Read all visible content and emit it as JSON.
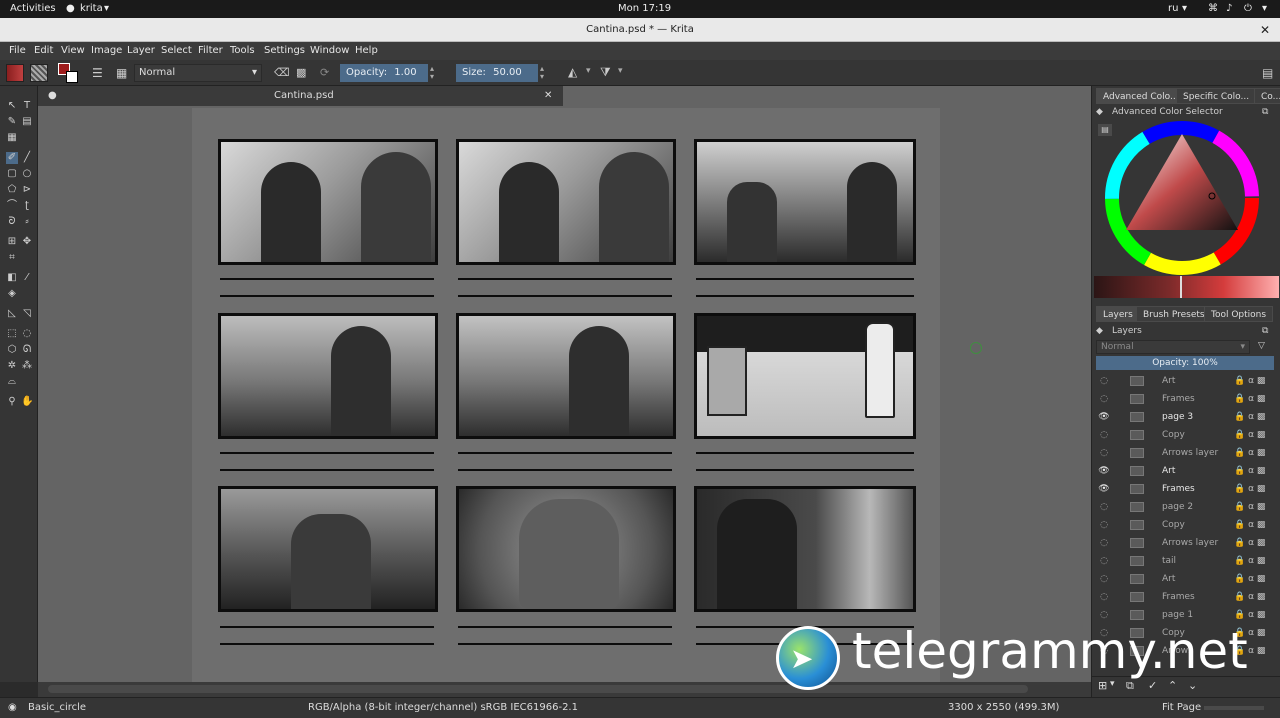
{
  "topbar": {
    "activities": "Activities",
    "app": "krita",
    "clock": "Mon 17:19",
    "lang": "ru"
  },
  "window": {
    "title": "Cantina.psd * — Krita"
  },
  "menu": [
    "File",
    "Edit",
    "View",
    "Image",
    "Layer",
    "Select",
    "Filter",
    "Tools",
    "Settings",
    "Window",
    "Help"
  ],
  "toolbar": {
    "blend_mode": "Normal",
    "opacity_label": "Opacity:",
    "opacity_value": "1.00",
    "size_label": "Size:",
    "size_value": "50.00 px"
  },
  "document_tab": {
    "name": "Cantina.psd"
  },
  "dock": {
    "color_tabs": [
      "Advanced Colo...",
      "Specific Colo...",
      "Co..."
    ],
    "color_selector_title": "Advanced Color Selector",
    "layer_tabs": [
      "Layers",
      "Brush Presets",
      "Tool Options"
    ],
    "layers_title": "Layers",
    "layers_blend": "Normal",
    "layers_opacity": "Opacity:  100%",
    "layers": [
      {
        "name": "Art",
        "selected": false
      },
      {
        "name": "Frames",
        "selected": false
      },
      {
        "name": "page 3",
        "selected": true
      },
      {
        "name": "Copy",
        "selected": false
      },
      {
        "name": "Arrows layer",
        "selected": false
      },
      {
        "name": "Art",
        "selected": true
      },
      {
        "name": "Frames",
        "selected": true
      },
      {
        "name": "page 2",
        "selected": false
      },
      {
        "name": "Copy",
        "selected": false
      },
      {
        "name": "Arrows layer",
        "selected": false
      },
      {
        "name": "tail",
        "selected": false
      },
      {
        "name": "Art",
        "selected": false
      },
      {
        "name": "Frames",
        "selected": false
      },
      {
        "name": "page 1",
        "selected": false
      },
      {
        "name": "Copy",
        "selected": false
      },
      {
        "name": "Arrows",
        "selected": false
      }
    ]
  },
  "status": {
    "brush": "Basic_circle",
    "color_model": "RGB/Alpha (8-bit integer/channel)  sRGB IEC61966-2.1",
    "dimensions": "3300 x 2550 (499.3M)",
    "zoom": "Fit Page"
  },
  "watermark": {
    "text": "telegrammy.net"
  }
}
